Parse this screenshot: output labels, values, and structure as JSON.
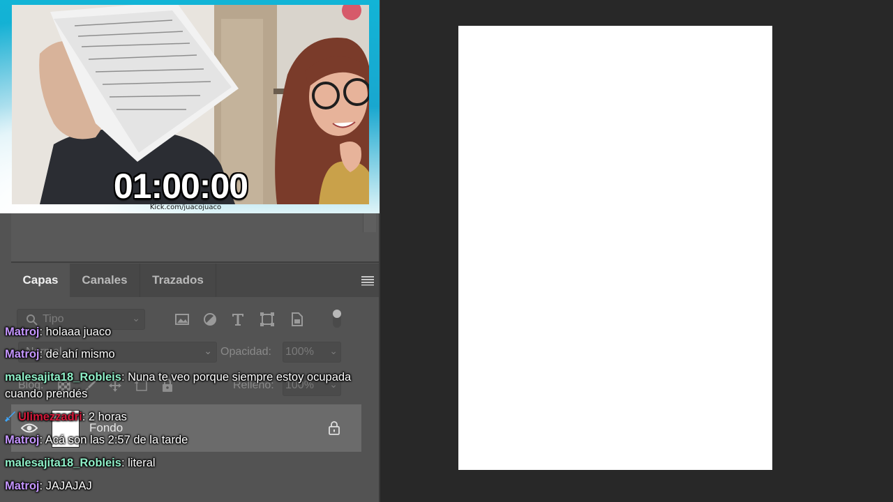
{
  "colors": {
    "canvas_bg": "#282828",
    "panel_bg": "#535353",
    "webcam_frame": "#12b4d6",
    "username_purple": "#c596ff",
    "username_mint": "#8ff0c8",
    "username_red": "#d3193a",
    "badge_blue": "#3fa8ff"
  },
  "webcam": {
    "timer": "01:00:00",
    "channel_url": "Kick.com/juacojuaco"
  },
  "layers_panel": {
    "tabs": [
      {
        "label": "Capas",
        "active": true
      },
      {
        "label": "Canales",
        "active": false
      },
      {
        "label": "Trazados",
        "active": false
      }
    ],
    "filter": {
      "label": "Tipo",
      "icon": "search-icon"
    },
    "filter_icons": [
      "image-icon",
      "adjustment-icon",
      "type-icon",
      "shape-icon",
      "smart-object-icon"
    ],
    "blend_mode": "Normal",
    "opacity_label": "Opacidad:",
    "opacity_value": "100%",
    "lock_label": "Bloq:",
    "fill_label": "Relleno:",
    "fill_value": "100%",
    "layer": {
      "name": "Fondo",
      "visible": true,
      "locked": true
    }
  },
  "chat": [
    {
      "user": "Matroj",
      "color": "#c596ff",
      "text": "holaaa juaco",
      "badge": false
    },
    {
      "user": "Matroj",
      "color": "#c596ff",
      "text": "de ahí mismo",
      "badge": false
    },
    {
      "user": "malesajita18_Robleis",
      "color": "#8ff0c8",
      "text": "Nuna te veo porque siempre estoy ocupada cuando prendés",
      "badge": false
    },
    {
      "user": "Ulimezzadri",
      "color": "#d3193a",
      "text": "2 horas",
      "badge": true
    },
    {
      "user": "Matroj",
      "color": "#c596ff",
      "text": "Acá son las 2:57 de la tarde",
      "badge": false
    },
    {
      "user": "malesajita18_Robleis",
      "color": "#8ff0c8",
      "text": "literal",
      "badge": false
    },
    {
      "user": "Matroj",
      "color": "#c596ff",
      "text": "JAJAJAJ",
      "badge": false
    }
  ]
}
